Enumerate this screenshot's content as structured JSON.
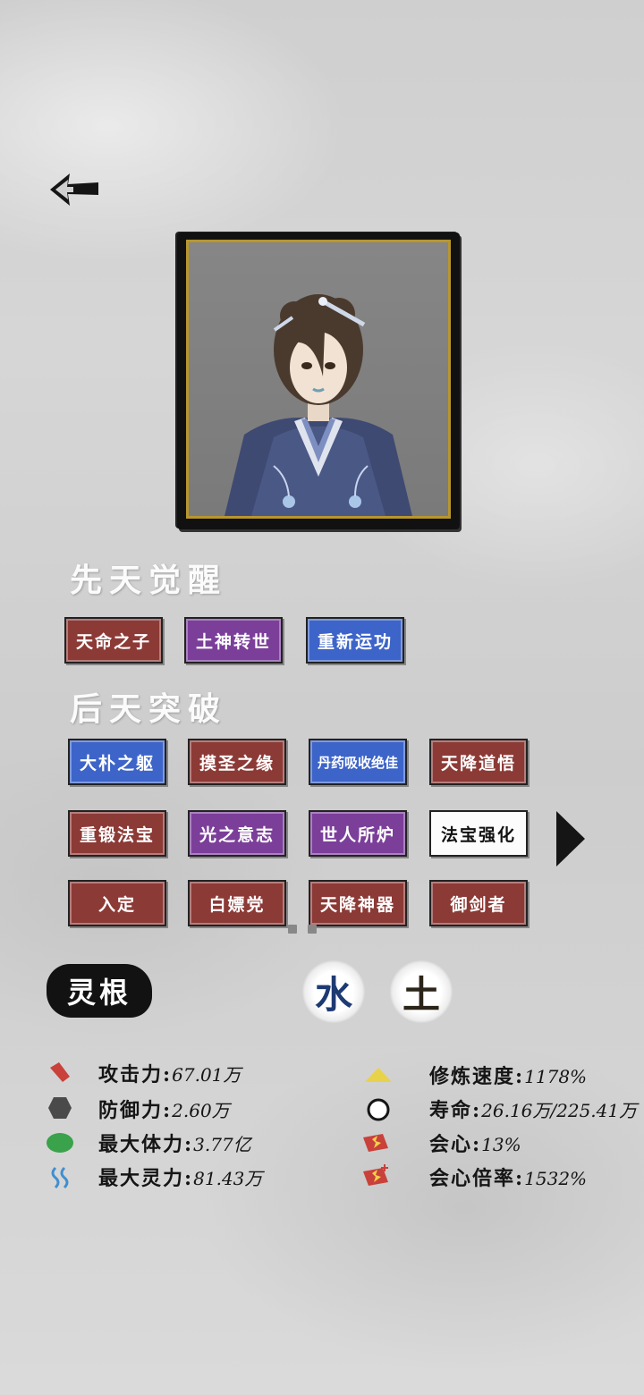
{
  "colors": {
    "tag_red": "#8c3a36",
    "tag_purple": "#7b3f9a",
    "tag_blue": "#3d64c8",
    "tag_white": "#fcfcfc",
    "frame_gold": "#b8962e",
    "water_blue": "#1e3a73",
    "earth_dark": "#2b2418"
  },
  "innate": {
    "title": "先天觉醒",
    "tags": [
      {
        "label": "天命之子",
        "color": "red"
      },
      {
        "label": "土神转世",
        "color": "purple"
      },
      {
        "label": "重新运功",
        "color": "blue"
      }
    ]
  },
  "acquired": {
    "title": "后天突破",
    "tags": [
      {
        "label": "大朴之躯",
        "color": "blue"
      },
      {
        "label": "摸圣之缘",
        "color": "red"
      },
      {
        "label": "丹药吸收绝佳",
        "color": "blue"
      },
      {
        "label": "天降道悟",
        "color": "red"
      },
      {
        "label": "重锻法宝",
        "color": "red"
      },
      {
        "label": "光之意志",
        "color": "purple"
      },
      {
        "label": "世人所炉",
        "color": "purple"
      },
      {
        "label": "法宝强化",
        "color": "white"
      },
      {
        "label": "入定",
        "color": "red"
      },
      {
        "label": "白嫖党",
        "color": "red"
      },
      {
        "label": "天降神器",
        "color": "red"
      },
      {
        "label": "御剑者",
        "color": "red"
      }
    ]
  },
  "spirit_root": {
    "label": "灵根",
    "elements": [
      "水",
      "土"
    ]
  },
  "stats_left": [
    {
      "name": "攻击力",
      "value": "67.01万",
      "icon": "attack-icon"
    },
    {
      "name": "防御力",
      "value": "2.60万",
      "icon": "defense-icon"
    },
    {
      "name": "最大体力",
      "value": "3.77亿",
      "icon": "health-icon"
    },
    {
      "name": "最大灵力",
      "value": "81.43万",
      "icon": "spirit-icon"
    }
  ],
  "stats_right": [
    {
      "name": "修炼速度",
      "value": "1178%",
      "icon": "cultivation-speed-icon"
    },
    {
      "name": "寿命",
      "value": "26.16万/225.41万",
      "icon": "lifespan-icon"
    },
    {
      "name": "会心",
      "value": "13%",
      "icon": "crit-icon"
    },
    {
      "name": "会心倍率",
      "value": "1532%",
      "icon": "crit-multiplier-icon"
    }
  ]
}
